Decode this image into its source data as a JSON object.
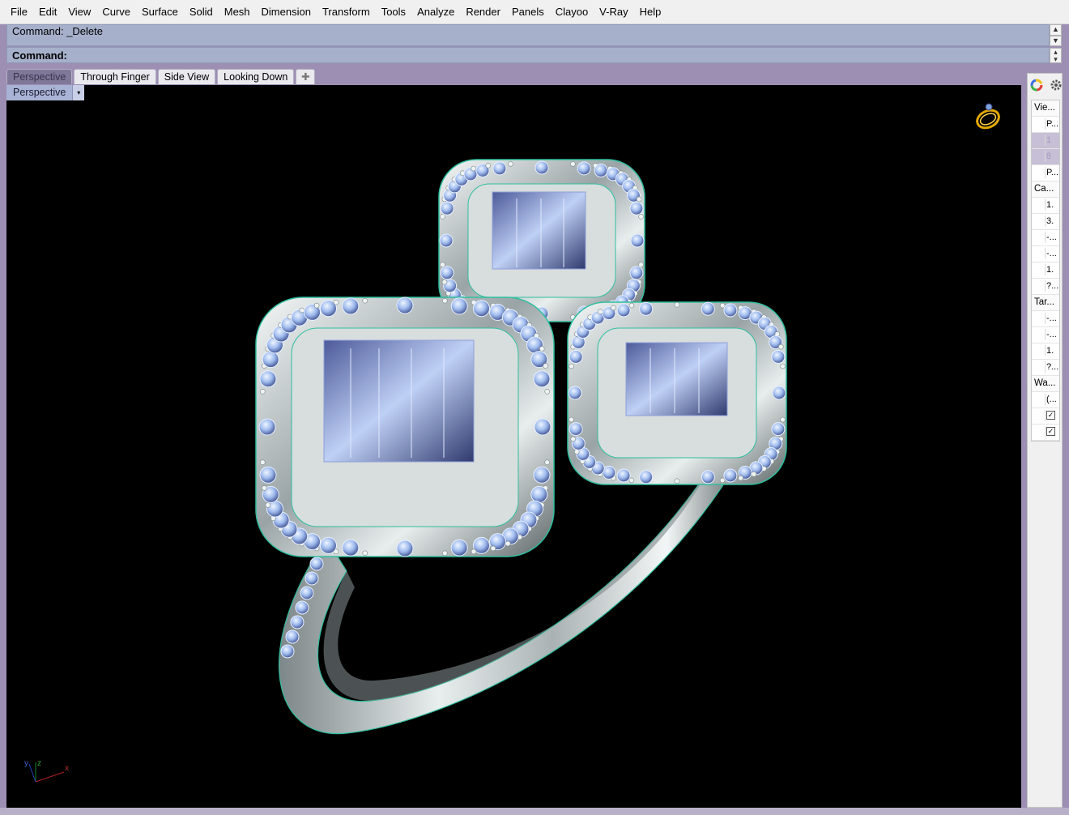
{
  "menu": [
    "File",
    "Edit",
    "View",
    "Curve",
    "Surface",
    "Solid",
    "Mesh",
    "Dimension",
    "Transform",
    "Tools",
    "Analyze",
    "Render",
    "Panels",
    "Clayoo",
    "V-Ray",
    "Help"
  ],
  "command": {
    "history": "Command: _Delete",
    "prompt": "Command:"
  },
  "tabs": [
    "Perspective",
    "Through Finger",
    "Side View",
    "Looking Down"
  ],
  "tab_add_symbol": "✚",
  "viewport": {
    "label": "Perspective",
    "dropdown_symbol": "▾",
    "axes": {
      "x": "x",
      "y": "y",
      "z": "z"
    }
  },
  "panel": {
    "rows": [
      {
        "type": "head",
        "text": "Vie..."
      },
      {
        "type": "item",
        "text": "P..."
      },
      {
        "type": "sel",
        "text": "1"
      },
      {
        "type": "sel",
        "text": "8"
      },
      {
        "type": "item",
        "text": "P..."
      },
      {
        "type": "head",
        "text": "Ca..."
      },
      {
        "type": "item",
        "text": "1."
      },
      {
        "type": "item",
        "text": "3."
      },
      {
        "type": "item",
        "text": "-..."
      },
      {
        "type": "item",
        "text": "-..."
      },
      {
        "type": "item",
        "text": "1."
      },
      {
        "type": "item",
        "text": "?..."
      },
      {
        "type": "head",
        "text": "Tar..."
      },
      {
        "type": "item",
        "text": "-..."
      },
      {
        "type": "item",
        "text": "-..."
      },
      {
        "type": "item",
        "text": "1."
      },
      {
        "type": "item",
        "text": "?..."
      },
      {
        "type": "head",
        "text": "Wa..."
      },
      {
        "type": "item",
        "text": "(..."
      },
      {
        "type": "check",
        "text": "✓"
      },
      {
        "type": "check",
        "text": "✓"
      }
    ]
  },
  "colors": {
    "metal": "#c9d3d3",
    "edge": "#2fbf9f",
    "stone": "#a9c6f0",
    "background": "#000000",
    "accent": "#9c8fb3"
  }
}
